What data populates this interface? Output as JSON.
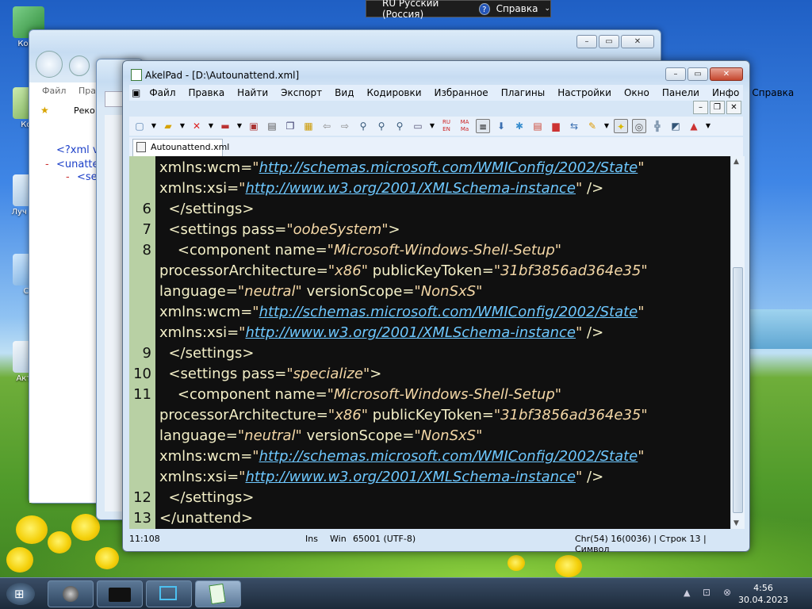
{
  "desktop": {
    "icons": [
      "Комп",
      "Кор",
      "Луч мод",
      "Со",
      "Актив"
    ]
  },
  "langbar": {
    "lang": "RU Русский (Россия)",
    "help": "Справка"
  },
  "backwin": {
    "menu_file": "Файл",
    "menu_edit": "Пра",
    "fav": "Реко",
    "xml1": "<?xml v",
    "xml2": "<unatte",
    "xml3": "<se",
    "minus": "-"
  },
  "window": {
    "title": "AkelPad - [D:\\Autounattend.xml]"
  },
  "menu": [
    "Файл",
    "Правка",
    "Найти",
    "Экспорт",
    "Вид",
    "Кодировки",
    "Избранное",
    "Плагины",
    "Настройки",
    "Окно",
    "Панели",
    "Инфо",
    "Справка"
  ],
  "tab": {
    "label": "Autounattend.xml"
  },
  "editor": {
    "lines": [
      {
        "n": "",
        "t": [
          [
            "a",
            "xmlns:wcm="
          ],
          [
            "v",
            "\""
          ],
          [
            "u",
            "http://schemas.microsoft.com/WMIConfig/2002/State"
          ],
          [
            "v",
            "\""
          ]
        ]
      },
      {
        "n": "",
        "t": [
          [
            "a",
            "xmlns:xsi="
          ],
          [
            "v",
            "\""
          ],
          [
            "u",
            "http://www.w3.org/2001/XMLSchema-instance"
          ],
          [
            "v",
            "\""
          ],
          [
            "a",
            " />"
          ]
        ]
      },
      {
        "n": "6",
        "t": [
          [
            "a",
            "  </settings>"
          ]
        ]
      },
      {
        "n": "7",
        "t": [
          [
            "a",
            "  <settings pass="
          ],
          [
            "v",
            "\"oobeSystem\""
          ],
          [
            "a",
            ">"
          ]
        ]
      },
      {
        "n": "8",
        "t": [
          [
            "a",
            "    <component name="
          ],
          [
            "v",
            "\"Microsoft-Windows-Shell-Setup\""
          ]
        ]
      },
      {
        "n": "",
        "t": [
          [
            "a",
            "processorArchitecture="
          ],
          [
            "v",
            "\"x86\""
          ],
          [
            "a",
            " publicKeyToken="
          ],
          [
            "v",
            "\"31bf3856ad364e35\""
          ]
        ]
      },
      {
        "n": "",
        "t": [
          [
            "a",
            "language="
          ],
          [
            "v",
            "\"neutral\""
          ],
          [
            "a",
            " versionScope="
          ],
          [
            "v",
            "\"NonSxS\""
          ]
        ]
      },
      {
        "n": "",
        "t": [
          [
            "a",
            "xmlns:wcm="
          ],
          [
            "v",
            "\""
          ],
          [
            "u",
            "http://schemas.microsoft.com/WMIConfig/2002/State"
          ],
          [
            "v",
            "\""
          ]
        ]
      },
      {
        "n": "",
        "t": [
          [
            "a",
            "xmlns:xsi="
          ],
          [
            "v",
            "\""
          ],
          [
            "u",
            "http://www.w3.org/2001/XMLSchema-instance"
          ],
          [
            "v",
            "\""
          ],
          [
            "a",
            " />"
          ]
        ]
      },
      {
        "n": "9",
        "t": [
          [
            "a",
            "  </settings>"
          ]
        ]
      },
      {
        "n": "10",
        "t": [
          [
            "a",
            "  <settings pass="
          ],
          [
            "v",
            "\"specialize\""
          ],
          [
            "a",
            ">"
          ]
        ]
      },
      {
        "n": "11",
        "t": [
          [
            "a",
            "    <component name="
          ],
          [
            "v",
            "\"Microsoft-Windows-Shell-Setup\""
          ]
        ]
      },
      {
        "n": "",
        "t": [
          [
            "a",
            "processorArchitecture="
          ],
          [
            "v",
            "\"x86\""
          ],
          [
            "a",
            " publicKeyToken="
          ],
          [
            "v",
            "\"31bf3856ad364e35\""
          ]
        ]
      },
      {
        "n": "",
        "t": [
          [
            "a",
            "language="
          ],
          [
            "v",
            "\"neutral\""
          ],
          [
            "a",
            " versionScope="
          ],
          [
            "v",
            "\"NonSxS\""
          ]
        ]
      },
      {
        "n": "",
        "t": [
          [
            "a",
            "xmlns:wcm="
          ],
          [
            "v",
            "\""
          ],
          [
            "u",
            "http://schemas.microsoft.com/WMIConfig/2002/State"
          ],
          [
            "v",
            "\""
          ]
        ]
      },
      {
        "n": "",
        "t": [
          [
            "a",
            "xmlns:xsi="
          ],
          [
            "v",
            "\""
          ],
          [
            "u",
            "http://www.w3.org/2001/XMLSchema-instance"
          ],
          [
            "v",
            "\""
          ],
          [
            "a",
            " />"
          ]
        ]
      },
      {
        "n": "12",
        "t": [
          [
            "a",
            "  </settings>"
          ]
        ]
      },
      {
        "n": "13",
        "t": [
          [
            "a",
            "</unattend>"
          ]
        ]
      }
    ]
  },
  "status": {
    "pos": "11:108",
    "ins": "Ins",
    "eol": "Win",
    "enc": "65001 (UTF-8)",
    "info": "Chr(54) 16(0036) | Строк 13 | Символ"
  },
  "clock": {
    "time": "4:56",
    "date": "30.04.2023"
  },
  "colors": {
    "bg": "#101010",
    "text": "#ffe46b",
    "url": "#6ec8ff",
    "gutter": "#b8d0a4"
  }
}
